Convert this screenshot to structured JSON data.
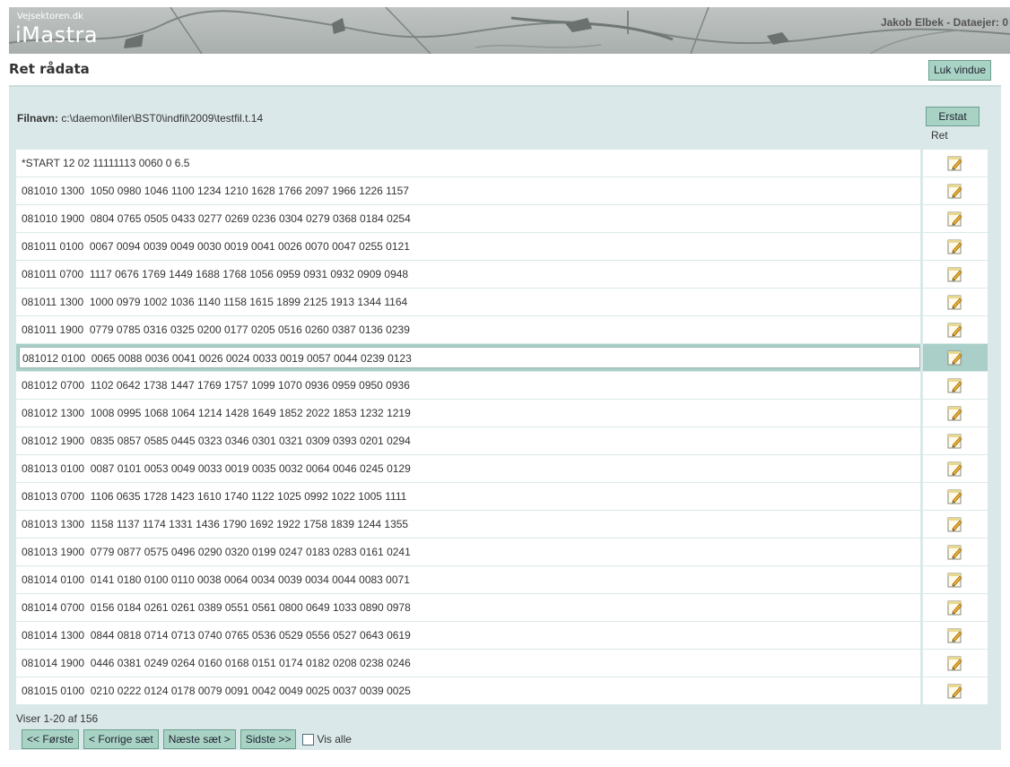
{
  "header": {
    "site": "Vejsektoren.dk",
    "app": "iMastra",
    "user": "Jakob Elbek - Dataejer: 0"
  },
  "page": {
    "title": "Ret rådata",
    "close_label": "Luk vindue"
  },
  "file": {
    "label": "Filnavn:",
    "path": "c:\\daemon\\filer\\BST0\\indfil\\2009\\testfil.t.14"
  },
  "replace_label": "Erstat",
  "edit_column_header": "Ret",
  "rows": [
    "*START 12 02 11111113 0060 0 6.5",
    "081010 1300  1050 0980 1046 1100 1234 1210 1628 1766 2097 1966 1226 1157",
    "081010 1900  0804 0765 0505 0433 0277 0269 0236 0304 0279 0368 0184 0254",
    "081011 0100  0067 0094 0039 0049 0030 0019 0041 0026 0070 0047 0255 0121",
    "081011 0700  1117 0676 1769 1449 1688 1768 1056 0959 0931 0932 0909 0948",
    "081011 1300  1000 0979 1002 1036 1140 1158 1615 1899 2125 1913 1344 1164",
    "081011 1900  0779 0785 0316 0325 0200 0177 0205 0516 0260 0387 0136 0239",
    "081012 0100  0065 0088 0036 0041 0026 0024 0033 0019 0057 0044 0239 0123",
    "081012 0700  1102 0642 1738 1447 1769 1757 1099 1070 0936 0959 0950 0936",
    "081012 1300  1008 0995 1068 1064 1214 1428 1649 1852 2022 1853 1232 1219",
    "081012 1900  0835 0857 0585 0445 0323 0346 0301 0321 0309 0393 0201 0294",
    "081013 0100  0087 0101 0053 0049 0033 0019 0035 0032 0064 0046 0245 0129",
    "081013 0700  1106 0635 1728 1423 1610 1740 1122 1025 0992 1022 1005 1111",
    "081013 1300  1158 1137 1174 1331 1436 1790 1692 1922 1758 1839 1244 1355",
    "081013 1900  0779 0877 0575 0496 0290 0320 0199 0247 0183 0283 0161 0241",
    "081014 0100  0141 0180 0100 0110 0038 0064 0034 0039 0034 0044 0083 0071",
    "081014 0700  0156 0184 0261 0261 0389 0551 0561 0800 0649 1033 0890 0978",
    "081014 1300  0844 0818 0714 0713 0740 0765 0536 0529 0556 0527 0643 0619",
    "081014 1900  0446 0381 0249 0264 0160 0168 0151 0174 0182 0208 0238 0246",
    "081015 0100  0210 0222 0124 0178 0079 0091 0042 0049 0025 0037 0039 0025"
  ],
  "selected_row_index": 7,
  "summary": "Viser 1-20 af 156",
  "pager": {
    "first": "<< Første",
    "prev": "< Forrige sæt",
    "next": "Næste sæt >",
    "last": "Sidste >>",
    "show_all": "Vis alle",
    "show_all_checked": false
  },
  "colors": {
    "panel": "#dbe8e9",
    "button": "#a8d3c4",
    "selected_row": "#a9cfc8"
  }
}
